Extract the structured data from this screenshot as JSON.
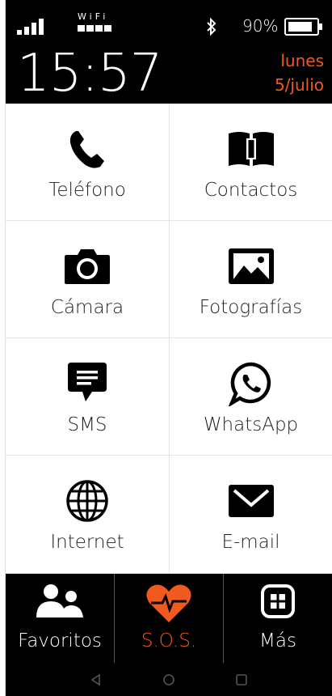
{
  "status_bar": {
    "wifi_label": "WiFi",
    "battery_percent": "90%",
    "time": "15:57",
    "day": "lunes",
    "date": "5/julio"
  },
  "apps": [
    {
      "label": "Teléfono",
      "icon": "phone-icon"
    },
    {
      "label": "Contactos",
      "icon": "contacts-book-icon"
    },
    {
      "label": "Cámara",
      "icon": "camera-icon"
    },
    {
      "label": "Fotografías",
      "icon": "photos-icon"
    },
    {
      "label": "SMS",
      "icon": "sms-icon"
    },
    {
      "label": "WhatsApp",
      "icon": "whatsapp-icon"
    },
    {
      "label": "Internet",
      "icon": "globe-icon"
    },
    {
      "label": "E-mail",
      "icon": "envelope-icon"
    }
  ],
  "dock": {
    "favorites_label": "Favoritos",
    "sos_label": "S.O.S.",
    "more_label": "Más"
  },
  "colors": {
    "accent": "#f05a1e",
    "bar_background": "#000000"
  }
}
